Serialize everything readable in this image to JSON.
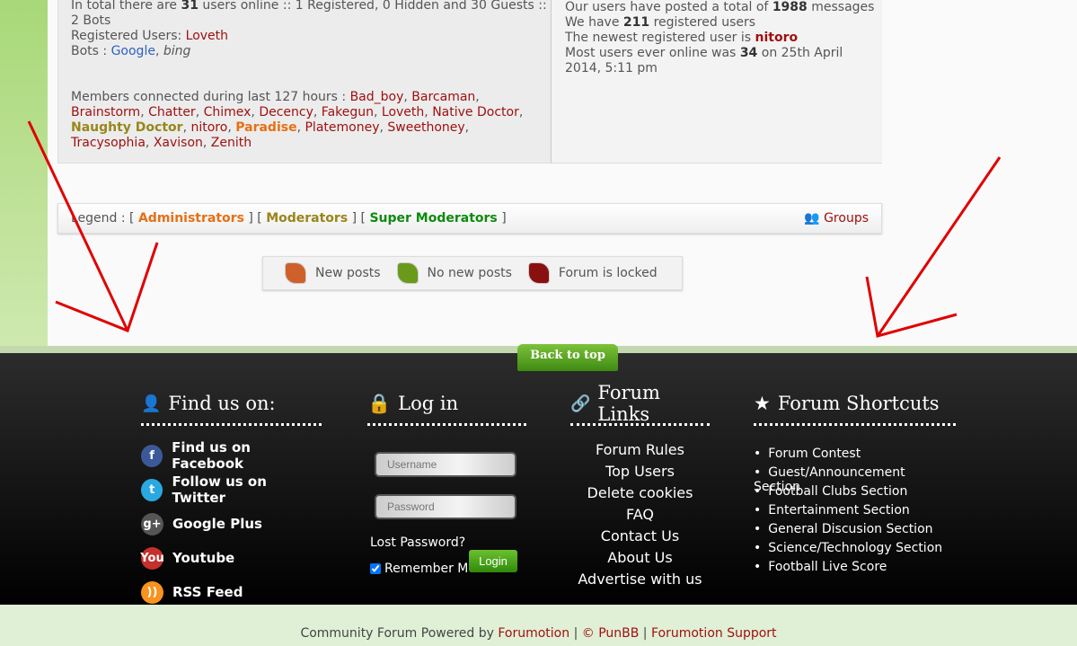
{
  "stats": {
    "online_prefix": "In total there are ",
    "online_count": "31",
    "online_suffix": " users online :: 1 Registered, 0 Hidden and 30 Guests :: 2 Bots",
    "registered_label": "Registered Users: ",
    "registered_user": "Loveth",
    "bots_label": "Bots : ",
    "bot_google": "Google",
    "bot_bing": "bing",
    "members_label": "Members connected during last 127 hours : ",
    "members": [
      {
        "name": "Bad_boy",
        "role": "red"
      },
      {
        "name": "Barcaman",
        "role": "red"
      },
      {
        "name": "Brainstorm",
        "role": "red"
      },
      {
        "name": "Chatter",
        "role": "red"
      },
      {
        "name": "Chimex",
        "role": "red"
      },
      {
        "name": "Decency",
        "role": "red"
      },
      {
        "name": "Fakegun",
        "role": "red"
      },
      {
        "name": "Loveth",
        "role": "red"
      },
      {
        "name": "Native Doctor",
        "role": "red"
      },
      {
        "name": "Naughty Doctor",
        "role": "mod"
      },
      {
        "name": "nitoro",
        "role": "red"
      },
      {
        "name": "Paradise",
        "role": "admin"
      },
      {
        "name": "Platemoney",
        "role": "red"
      },
      {
        "name": "Sweethoney",
        "role": "red"
      },
      {
        "name": "Tracysophia",
        "role": "red"
      },
      {
        "name": "Xavison",
        "role": "red"
      },
      {
        "name": "Zenith",
        "role": "red"
      }
    ],
    "posts_prefix": "Our users have posted a total of ",
    "posts_count": "1988",
    "posts_suffix": " messages",
    "reg_prefix": "We have ",
    "reg_count": "211",
    "reg_suffix": " registered users",
    "newest_prefix": "The newest registered user is ",
    "newest_user": "nitoro",
    "most_prefix": "Most users ever online was ",
    "most_count": "34",
    "most_suffix": " on 25th April 2014, 5:11 pm"
  },
  "legend": {
    "label": "Legend : ",
    "admins": "Administrators",
    "mods": "Moderators",
    "smods": "Super Moderators",
    "groups": "Groups"
  },
  "post_icons": [
    {
      "label": "New posts",
      "color": "#d0602a"
    },
    {
      "label": "No new posts",
      "color": "#6a9a1a"
    },
    {
      "label": "Forum is locked",
      "color": "#8a1010"
    }
  ],
  "back_to_top": "Back to top",
  "find_us": {
    "title": "Find us on:",
    "items": [
      {
        "label": "Find us on Facebook",
        "icon": "facebook-icon",
        "glyph": "f",
        "color": "#3b5998"
      },
      {
        "label": "Follow us on Twitter",
        "icon": "twitter-icon",
        "glyph": "t",
        "color": "#2aa9e0"
      },
      {
        "label": "Google Plus",
        "icon": "google-plus-icon",
        "glyph": "g+",
        "color": "#555"
      },
      {
        "label": "Youtube",
        "icon": "youtube-icon",
        "glyph": "You",
        "color": "#c4302b"
      },
      {
        "label": "RSS Feed",
        "icon": "rss-icon",
        "glyph": "))",
        "color": "#f7931e"
      }
    ]
  },
  "login": {
    "title": "Log in",
    "username_placeholder": "Username",
    "password_placeholder": "Password",
    "lost": "Lost Password?",
    "remember": "Remember Me",
    "button": "Login"
  },
  "forum_links": {
    "title": "Forum Links",
    "items": [
      "Forum Rules",
      "Top Users",
      "Delete cookies",
      "FAQ",
      "Contact Us",
      "About Us",
      "Advertise with us"
    ]
  },
  "shortcuts": {
    "title": "Forum Shortcuts",
    "items": [
      "Forum Contest",
      "Guest/Announcement Section",
      "Football Clubs Section",
      "Entertainment Section",
      "General Discusion Section",
      "Science/Technology Section",
      "Football Live Score"
    ]
  },
  "bottom": {
    "prefix": "Community Forum Powered by ",
    "forumotion": "Forumotion",
    "sep1": " | ",
    "punbb": "© PunBB",
    "sep2": " | ",
    "support": "Forumotion Support"
  }
}
